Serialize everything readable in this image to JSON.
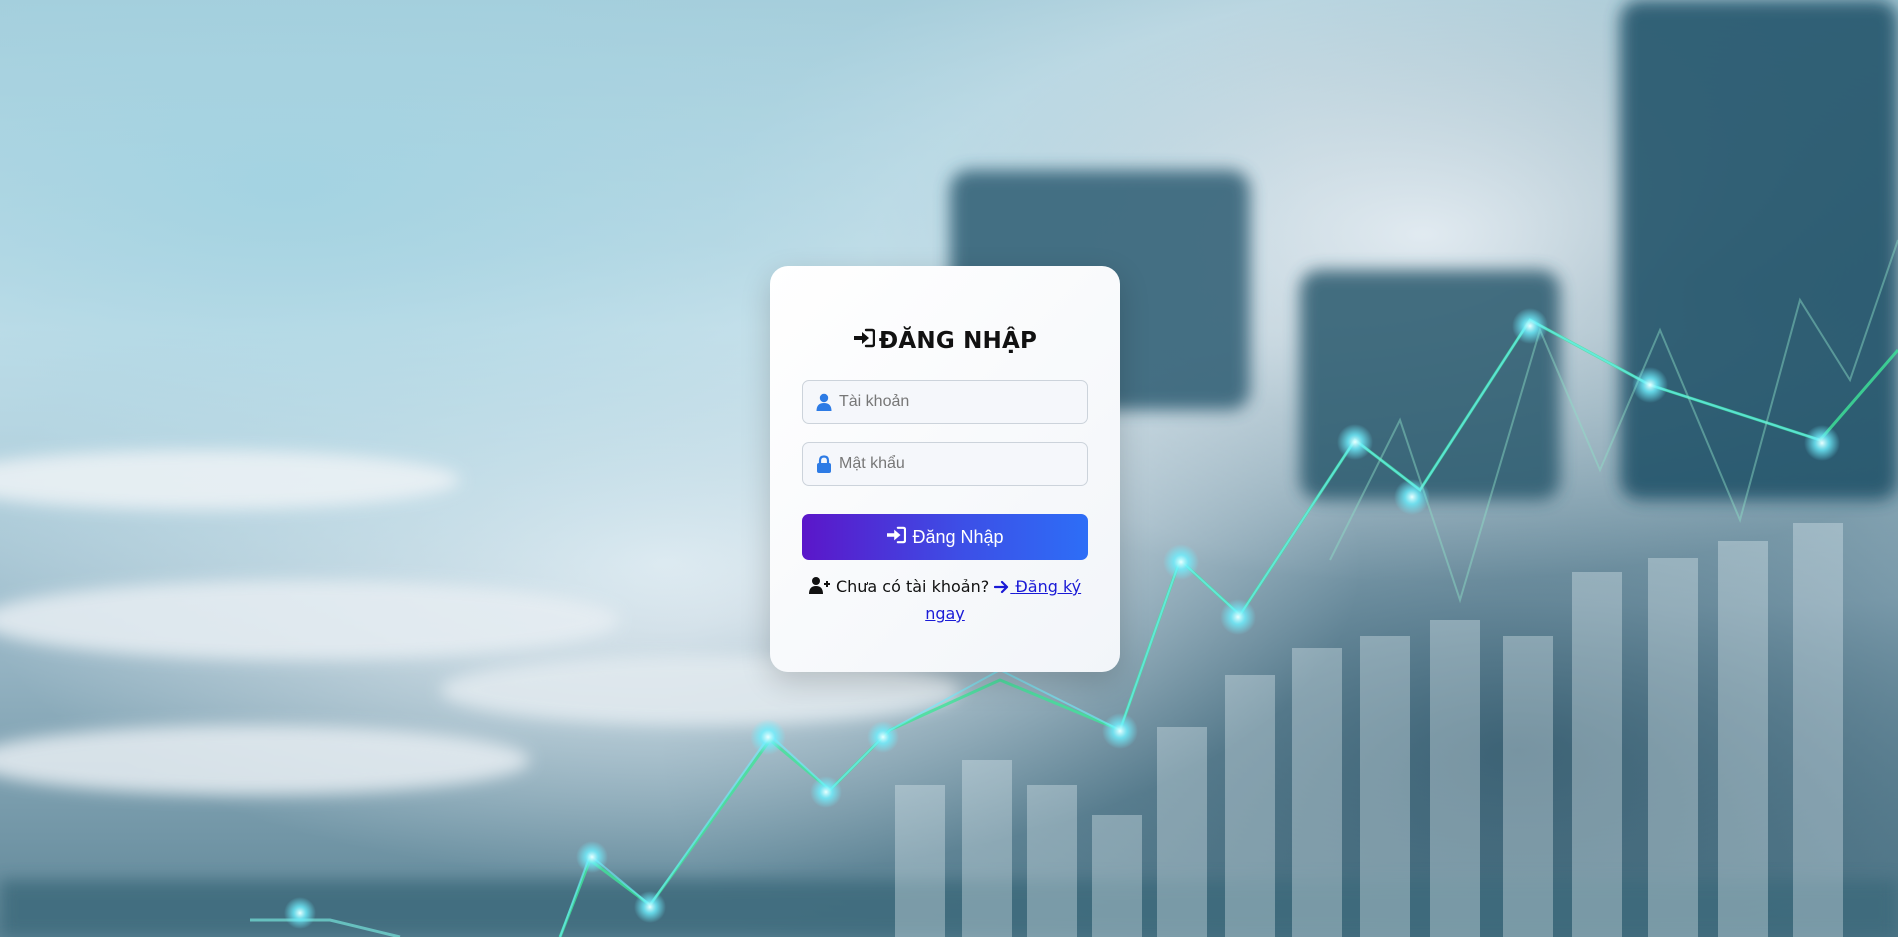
{
  "login": {
    "title": "ĐĂNG NHẬP",
    "username_placeholder": "Tài khoản",
    "password_placeholder": "Mật khẩu",
    "submit_label": "Đăng Nhập",
    "no_account_text": "Chưa có tài khoản?",
    "register_link": "Đăng ký ngay"
  },
  "icons": {
    "title": "sign-in-icon",
    "username": "user-icon",
    "password": "lock-icon",
    "submit": "sign-in-icon",
    "register_prompt": "user-plus-icon",
    "register_link": "arrow-right-icon"
  },
  "colors": {
    "accent_start": "#5b16c9",
    "accent_end": "#2d6ef7",
    "icon_blue": "#2d7be5",
    "link": "#1a1ad6"
  }
}
